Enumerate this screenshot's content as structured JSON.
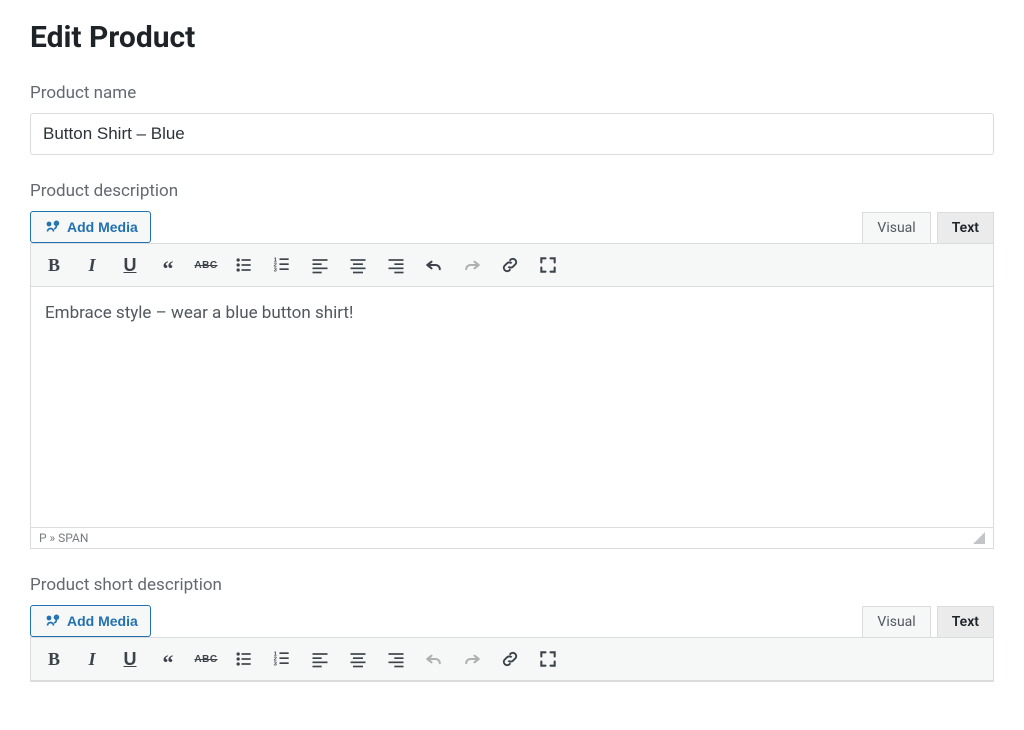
{
  "page": {
    "title": "Edit Product"
  },
  "product_name": {
    "label": "Product name",
    "value": "Button Shirt – Blue"
  },
  "description": {
    "label": "Product description",
    "add_media_label": "Add Media",
    "tab_visual": "Visual",
    "tab_text": "Text",
    "active_tab": "Text",
    "content": "Embrace style – wear a blue button shirt!",
    "status_path": "P » SPAN"
  },
  "short_description": {
    "label": "Product short description",
    "add_media_label": "Add Media",
    "tab_visual": "Visual",
    "tab_text": "Text",
    "active_tab": "Text"
  },
  "toolbar_icons": [
    "bold",
    "italic",
    "underline",
    "blockquote",
    "strikethrough",
    "bullet-list",
    "numbered-list",
    "align-left",
    "align-center",
    "align-right",
    "undo",
    "redo",
    "link",
    "fullscreen"
  ]
}
